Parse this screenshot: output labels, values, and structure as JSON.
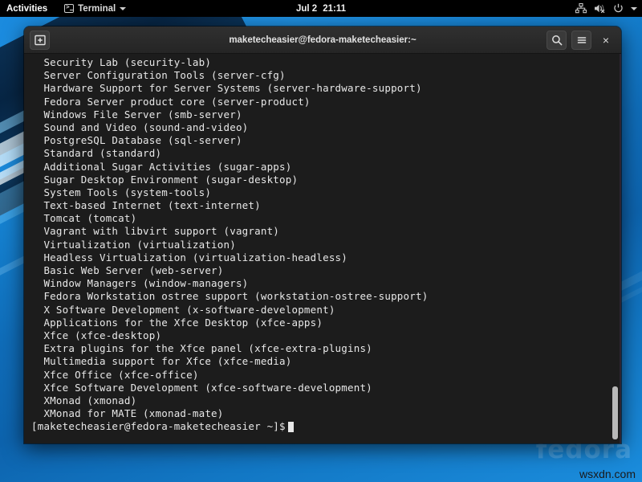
{
  "topbar": {
    "activities": "Activities",
    "app_menu": {
      "label": "Terminal",
      "icon": "terminal-icon",
      "caret": "chevron-down-icon"
    },
    "clock": {
      "date": "Jul 2",
      "time": "21:11"
    },
    "tray": [
      {
        "name": "network-icon",
        "label": "network"
      },
      {
        "name": "volume-muted-icon",
        "label": "volume muted"
      },
      {
        "name": "power-icon",
        "label": "power"
      },
      {
        "name": "chevron-down-icon",
        "label": "menu"
      }
    ],
    "bg": "#000000",
    "fg": "#e6e6e6"
  },
  "window": {
    "title": "maketecheasier@fedora-maketecheasier:~",
    "left_button": "new-terminal-icon",
    "search_button": "search-icon",
    "menu_button": "hamburger-menu-icon",
    "close_button": "×",
    "titlebar_bg": "#2a2a2a",
    "body_bg": "#1c1c1c"
  },
  "terminal": {
    "fg": "#e8e8e8",
    "lines": [
      "  Security Lab (security-lab)",
      "  Server Configuration Tools (server-cfg)",
      "  Hardware Support for Server Systems (server-hardware-support)",
      "  Fedora Server product core (server-product)",
      "  Windows File Server (smb-server)",
      "  Sound and Video (sound-and-video)",
      "  PostgreSQL Database (sql-server)",
      "  Standard (standard)",
      "  Additional Sugar Activities (sugar-apps)",
      "  Sugar Desktop Environment (sugar-desktop)",
      "  System Tools (system-tools)",
      "  Text-based Internet (text-internet)",
      "  Tomcat (tomcat)",
      "  Vagrant with libvirt support (vagrant)",
      "  Virtualization (virtualization)",
      "  Headless Virtualization (virtualization-headless)",
      "  Basic Web Server (web-server)",
      "  Window Managers (window-managers)",
      "  Fedora Workstation ostree support (workstation-ostree-support)",
      "  X Software Development (x-software-development)",
      "  Applications for the Xfce Desktop (xfce-apps)",
      "  Xfce (xfce-desktop)",
      "  Extra plugins for the Xfce panel (xfce-extra-plugins)",
      "  Multimedia support for Xfce (xfce-media)",
      "  Xfce Office (xfce-office)",
      "  Xfce Software Development (xfce-software-development)",
      "  XMonad (xmonad)",
      "  XMonad for MATE (xmonad-mate)"
    ],
    "prompt": "[maketecheasier@fedora-maketecheasier ~]$",
    "cursor": "block"
  },
  "desktop": {
    "watermark": "fedora",
    "site_watermark": "wsxdn.com",
    "accent": "#1a8ade"
  }
}
